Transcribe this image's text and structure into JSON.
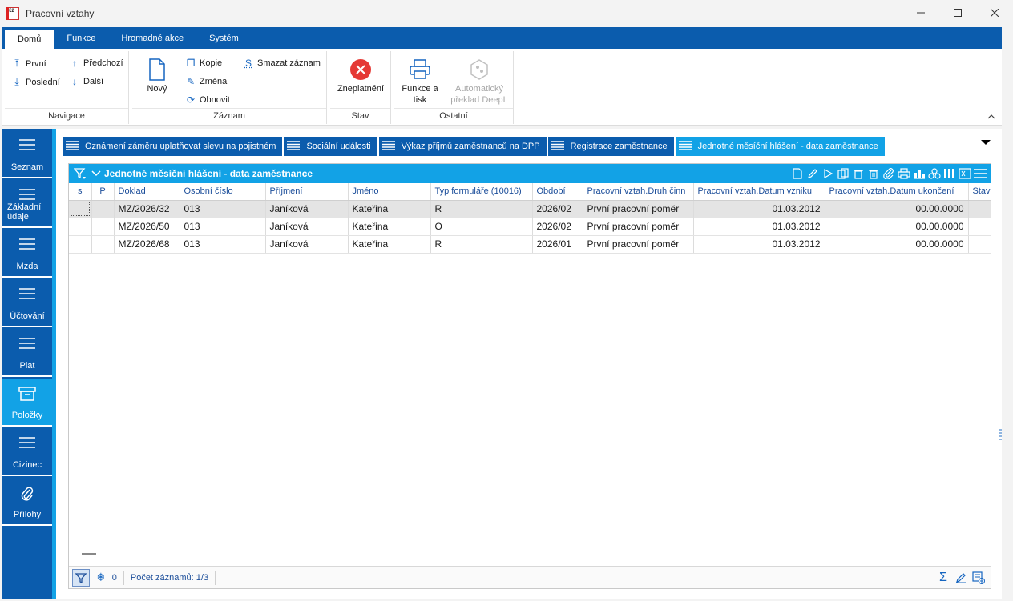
{
  "window": {
    "title": "Pracovní vztahy",
    "app_icon_text": "K2"
  },
  "ribbon_tabs": [
    {
      "label": "Domů",
      "active": true
    },
    {
      "label": "Funkce"
    },
    {
      "label": "Hromadné akce"
    },
    {
      "label": "Systém"
    }
  ],
  "ribbon": {
    "navigace": {
      "label": "Navigace",
      "first": "První",
      "last": "Poslední",
      "prev": "Předchozí",
      "next": "Další"
    },
    "zaznam": {
      "label": "Záznam",
      "new": "Nový",
      "copy": "Kopie",
      "change": "Změna",
      "refresh": "Obnovit",
      "delete": "Smazat záznam"
    },
    "stav": {
      "label": "Stav",
      "invalidate": "Zneplatnění"
    },
    "ostatni": {
      "label": "Ostatní",
      "functions_l1": "Funkce a",
      "functions_l2": "tisk",
      "deepl_l1": "Automatický",
      "deepl_l2": "překlad DeepL"
    }
  },
  "leftnav": [
    {
      "label": "Seznam"
    },
    {
      "label": "Základní údaje"
    },
    {
      "label": "Mzda"
    },
    {
      "label": "Účtování"
    },
    {
      "label": "Plat"
    },
    {
      "label": "Položky",
      "active": true
    },
    {
      "label": "Cizinec"
    },
    {
      "label": "Přílohy"
    }
  ],
  "doc_tabs": [
    {
      "label": "Oznámení záměru uplatňovat slevu na pojistném"
    },
    {
      "label": "Sociální události"
    },
    {
      "label": "Výkaz příjmů zaměstnanců na DPP"
    },
    {
      "label": "Registrace zaměstnance"
    },
    {
      "label": "Jednotné měsíční hlášení - data zaměstnance",
      "active": true
    }
  ],
  "grid": {
    "title": "Jednotné měsíční hlášení - data zaměstnance",
    "columns": [
      "s",
      "P",
      "Doklad",
      "Osobní číslo",
      "Příjmení",
      "Jméno",
      "Typ formuláře (10016)",
      "Období",
      "Pracovní vztah.Druh činn",
      "Pracovní vztah.Datum vzniku",
      "Pracovní vztah.Datum ukončení",
      "Stav"
    ],
    "rows": [
      [
        "",
        "",
        "MZ/2026/32",
        "013",
        "Janíková",
        "Kateřina",
        "R",
        "2026/02",
        "První pracovní poměr",
        "01.03.2012",
        "00.00.0000",
        ""
      ],
      [
        "",
        "",
        "MZ/2026/50",
        "013",
        "Janíková",
        "Kateřina",
        "O",
        "2026/02",
        "První pracovní poměr",
        "01.03.2012",
        "00.00.0000",
        ""
      ],
      [
        "",
        "",
        "MZ/2026/68",
        "013",
        "Janíková",
        "Kateřina",
        "R",
        "2026/01",
        "První pracovní poměr",
        "01.03.2012",
        "00.00.0000",
        ""
      ]
    ],
    "footer": {
      "snow_count": "0",
      "record_count": "Počet záznamů: 1/3"
    }
  },
  "colors": {
    "primary": "#0b5cad",
    "accent": "#12a2e6",
    "danger": "#e53935"
  }
}
